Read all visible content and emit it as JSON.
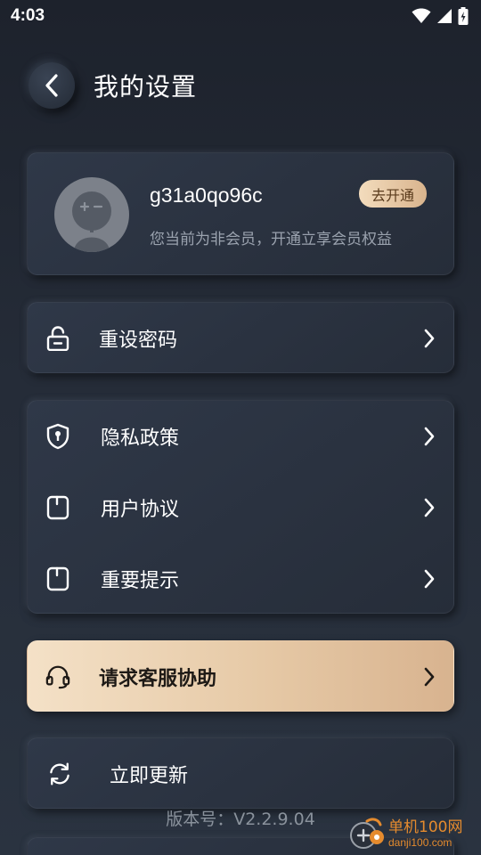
{
  "status_bar": {
    "time": "4:03",
    "icons": [
      "wifi-icon",
      "signal-icon",
      "battery-charging-icon"
    ]
  },
  "header": {
    "back_icon": "chevron-left-icon",
    "title": "我的设置"
  },
  "profile": {
    "username": "g31a0qo96c",
    "member_note": "您当前为非会员，开通立享会员权益",
    "vip_button": "去开通",
    "avatar_icon": "default-avatar-icon"
  },
  "menu": {
    "reset_password": {
      "label": "重设密码",
      "icon": "unlock-icon"
    },
    "privacy_policy": {
      "label": "隐私政策",
      "icon": "shield-icon"
    },
    "user_agreement": {
      "label": "用户协议",
      "icon": "document-icon"
    },
    "important_notice": {
      "label": "重要提示",
      "icon": "document-icon"
    },
    "customer_service": {
      "label": "请求客服协助",
      "icon": "headset-icon"
    },
    "update_now": {
      "label": "立即更新",
      "icon": "refresh-icon"
    }
  },
  "version": "版本号：V2.2.9.04",
  "watermark": {
    "name": "单机100网",
    "url": "danji100.com"
  },
  "colors": {
    "background": "#1d222c",
    "card": "#2b3342",
    "accent_gold_start": "#f4e1c7",
    "accent_gold_end": "#d8b38f",
    "secondary_text": "#9aa2ae"
  }
}
